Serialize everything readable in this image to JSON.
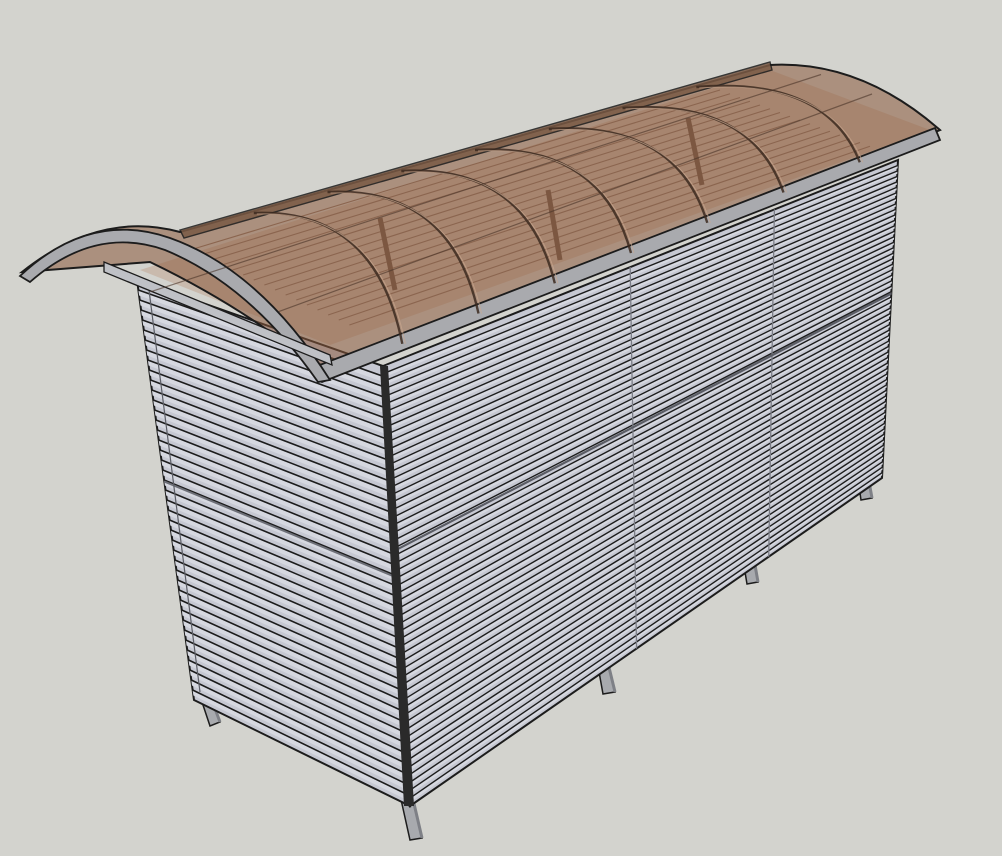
{
  "scene": {
    "description_visible_text": "",
    "colors": {
      "background": "#d3d3ce",
      "slat_face": "#c6c8d2",
      "slat_face_light": "#d6d8e0",
      "slat_shadow": "#8e909a",
      "outline": "#1c1c1c",
      "roof_tint": "#8a5a3c",
      "roof_tint_opacity": "0.55",
      "frame": "#a9aaae",
      "leg": "#a8aaae"
    },
    "objects": [
      "shed-body",
      "slatted-end-wall",
      "slatted-long-wall",
      "curved-translucent-roof",
      "roof-arch-ribs",
      "support-legs"
    ]
  }
}
